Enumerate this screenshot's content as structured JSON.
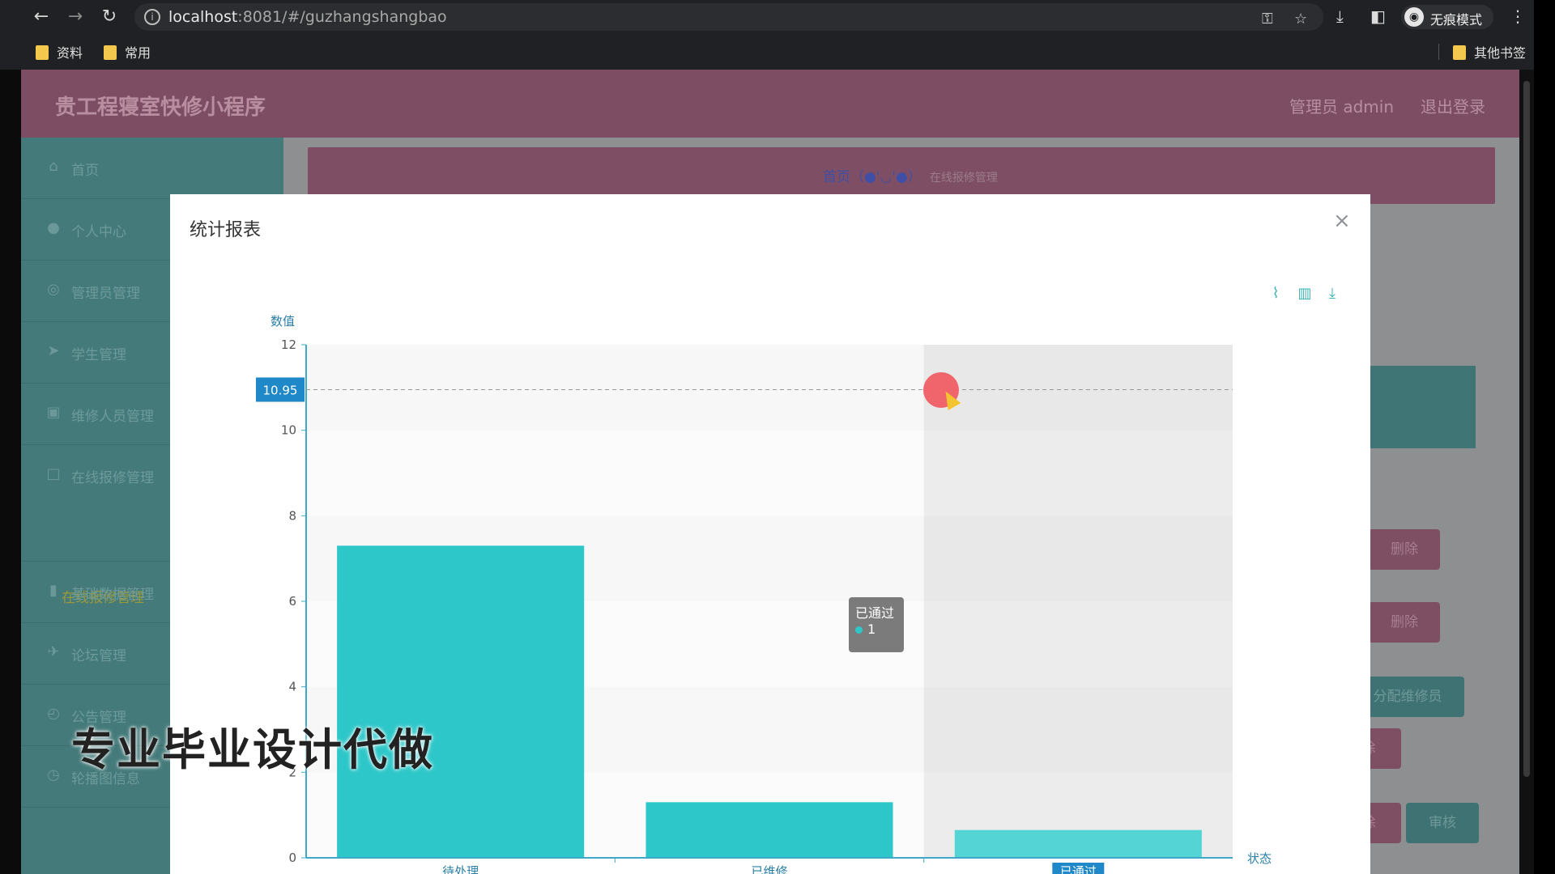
{
  "browser": {
    "url_host": "localhost",
    "url_rest": ":8081/#/guzhangshangbao",
    "incognito_label": "无痕模式",
    "bookmarks": [
      "资料",
      "常用"
    ],
    "other_bookmarks": "其他书签"
  },
  "app": {
    "title": "贵工程寝室快修小程序",
    "user": "管理员 admin",
    "logout": "退出登录"
  },
  "sidebar": {
    "items": [
      {
        "label": "首页",
        "icon": "home-icon"
      },
      {
        "label": "个人中心",
        "icon": "user-icon"
      },
      {
        "label": "管理员管理",
        "icon": "compass-icon"
      },
      {
        "label": "学生管理",
        "icon": "send-icon"
      },
      {
        "label": "维修人员管理",
        "icon": "image-icon"
      },
      {
        "label": "在线报修管理",
        "icon": "square-icon"
      },
      {
        "label": "基础数据管理",
        "icon": "bar-chart-icon"
      },
      {
        "label": "论坛管理",
        "icon": "plane-icon"
      },
      {
        "label": "公告管理",
        "icon": "clock-icon"
      },
      {
        "label": "轮播图信息",
        "icon": "history-icon"
      }
    ],
    "sub_item": "在线报修管理"
  },
  "breadcrumb": {
    "home": "首页（●'◡'●）",
    "current": "在线报修管理"
  },
  "background_buttons": {
    "delete": "删除",
    "assign": "分配维修员",
    "review": "审核",
    "del_partial": "除"
  },
  "modal": {
    "title": "统计报表",
    "close": "×"
  },
  "chart_data": {
    "type": "bar",
    "categories": [
      "待处理",
      "已维修",
      "已通过"
    ],
    "values": [
      7.3,
      1.3,
      0.65
    ],
    "ylabel": "数值",
    "xlabel": "状态",
    "ylim": [
      0,
      12
    ],
    "yticks": [
      0,
      2,
      4,
      6,
      8,
      10,
      12
    ],
    "crosshair_value": "10.95",
    "highlighted_category": "已通过",
    "bar_color": "#2ec7c9",
    "axis_color": "#3fa7c7",
    "tooltip": {
      "title": "已通过",
      "value": "1"
    },
    "grid": true
  },
  "watermark": "专业毕业设计代做"
}
